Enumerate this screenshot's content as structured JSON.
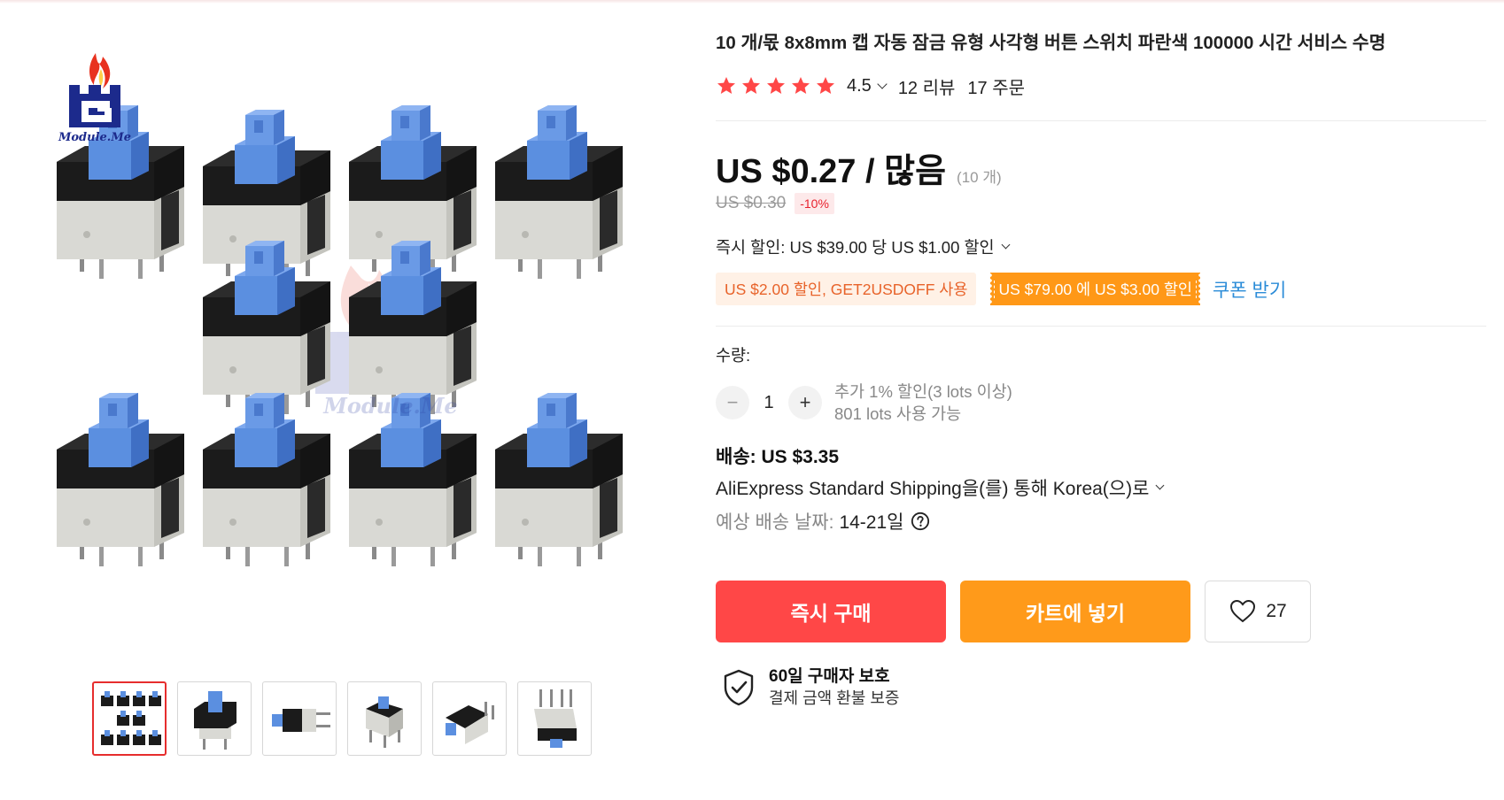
{
  "product": {
    "title": "10 개/몫 8x8mm 캡 자동 잠금 유형 사각형 버튼 스위치 파란색 100000 시간 서비스 수명"
  },
  "gallery": {
    "logo_text": "Module.Me",
    "watermark_text": "Module.Me",
    "thumbnail_count": 6,
    "active_thumbnail": 0
  },
  "rating": {
    "stars": 5,
    "value": "4.5",
    "reviews": "12 리뷰",
    "orders": "17 주문",
    "star_color": "#ff4747"
  },
  "price": {
    "current": "US $0.27 / 많음",
    "unit": "(10 개)",
    "original": "US $0.30",
    "discount": "-10%"
  },
  "promotions": {
    "instant_discount": "즉시 할인: US $39.00 당 US $1.00 할인",
    "coupon_code": "US $2.00 할인, GET2USDOFF 사용",
    "store_coupon": "US $79.00 에 US $3.00 할인",
    "get_coupon_link": "쿠폰 받기"
  },
  "quantity": {
    "label": "수량:",
    "minus": "−",
    "value": "1",
    "plus": "+",
    "extra_discount": "추가 1% 할인(3 lots 이상)",
    "available": "801 lots 사용 가능"
  },
  "shipping": {
    "label": "배송: US $3.35",
    "method": "AliExpress Standard Shipping을(를) 통해 Korea(으)로",
    "eta_label": "예상 배송 날짜:",
    "eta_value": "14-21일"
  },
  "actions": {
    "buy_now": "즉시 구매",
    "add_to_cart": "카트에 넣기",
    "wishlist_count": "27",
    "buy_color": "#ff4747",
    "cart_color": "#ff9a1a"
  },
  "protection": {
    "title": "60일 구매자 보호",
    "subtitle": "결제 금액 환불 보증"
  }
}
